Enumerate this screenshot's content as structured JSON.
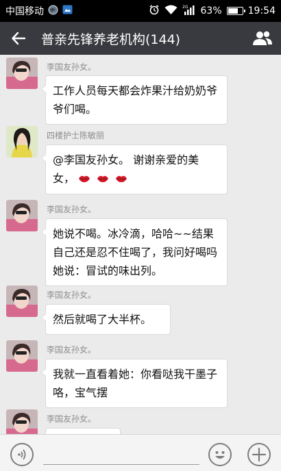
{
  "status_bar": {
    "carrier": "中国移动",
    "network_type": "2G",
    "battery_percent": "63%",
    "battery_level": 0.63,
    "time": "19:54"
  },
  "header": {
    "title": "普亲先锋养老机构(144)",
    "back_icon": "arrow-left-icon",
    "group_icon": "group-members-icon"
  },
  "messages": [
    {
      "sender": "李国友孙女。",
      "text": "工作人员每天都会炸果汁给奶奶爷爷们喝。"
    },
    {
      "sender": "四楼护士陈敏丽",
      "text": "@李国友孙女。 谢谢亲爱的美女，",
      "emoji": [
        "lips-emoji",
        "lips-emoji",
        "lips-emoji"
      ]
    },
    {
      "sender": "李国友孙女。",
      "text": "她说不喝。冰冷滴，哈哈~~结果自己还是忍不住喝了，我问好喝吗她说：冒试的味出列。"
    },
    {
      "sender": "李国友孙女。",
      "text": "然后就喝了大半杯。"
    },
    {
      "sender": "李国友孙女。",
      "text": "我就一直看着她：你看哒我干墨子咯，宝气摆"
    },
    {
      "sender": "李国友孙女。",
      "text": ""
    }
  ],
  "input_bar": {
    "value": "",
    "voice_icon": "voice-icon",
    "emoji_icon": "emoji-icon",
    "plus_icon": "plus-icon"
  },
  "colors": {
    "header_bg": "#393a3f",
    "chat_bg": "#ebebeb",
    "bubble_bg": "#ffffff",
    "lips": "#d21a2a"
  }
}
